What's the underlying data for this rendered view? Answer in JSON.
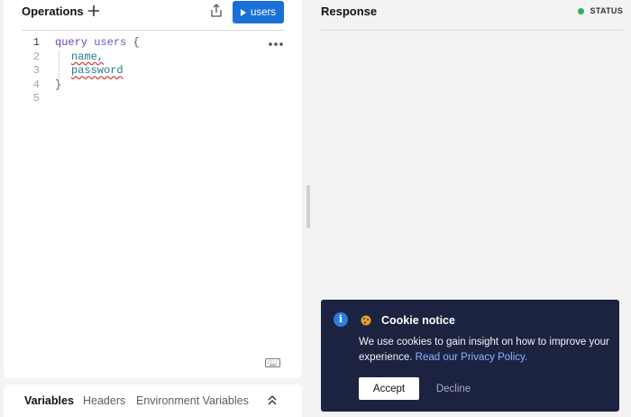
{
  "operations": {
    "title": "Operations",
    "run_label": "users",
    "line_numbers": [
      "1",
      "2",
      "3",
      "4",
      "5"
    ],
    "code": {
      "keyword": "query",
      "operation_name": "users",
      "open_brace": "{",
      "fields": [
        "name,",
        "password"
      ],
      "close_brace": "}"
    }
  },
  "bottom_tabs": [
    "Variables",
    "Headers",
    "Environment Variables"
  ],
  "response": {
    "title": "Response",
    "status_label": "STATUS",
    "status_color": "#2bb24c"
  },
  "cookie_notice": {
    "title": "Cookie notice",
    "text": "We use cookies to gain insight on how to improve your experience.",
    "link_text": "Read our Privacy Policy.",
    "accept_label": "Accept",
    "decline_label": "Decline"
  },
  "colors": {
    "accent": "#1a70d6",
    "banner_bg": "#1c2340",
    "link": "#8ab4ff"
  },
  "icons": [
    "plus-icon",
    "share-icon",
    "play-icon",
    "more-icon",
    "keyboard-icon",
    "chevrons-up-icon",
    "info-icon",
    "cookie-icon"
  ]
}
